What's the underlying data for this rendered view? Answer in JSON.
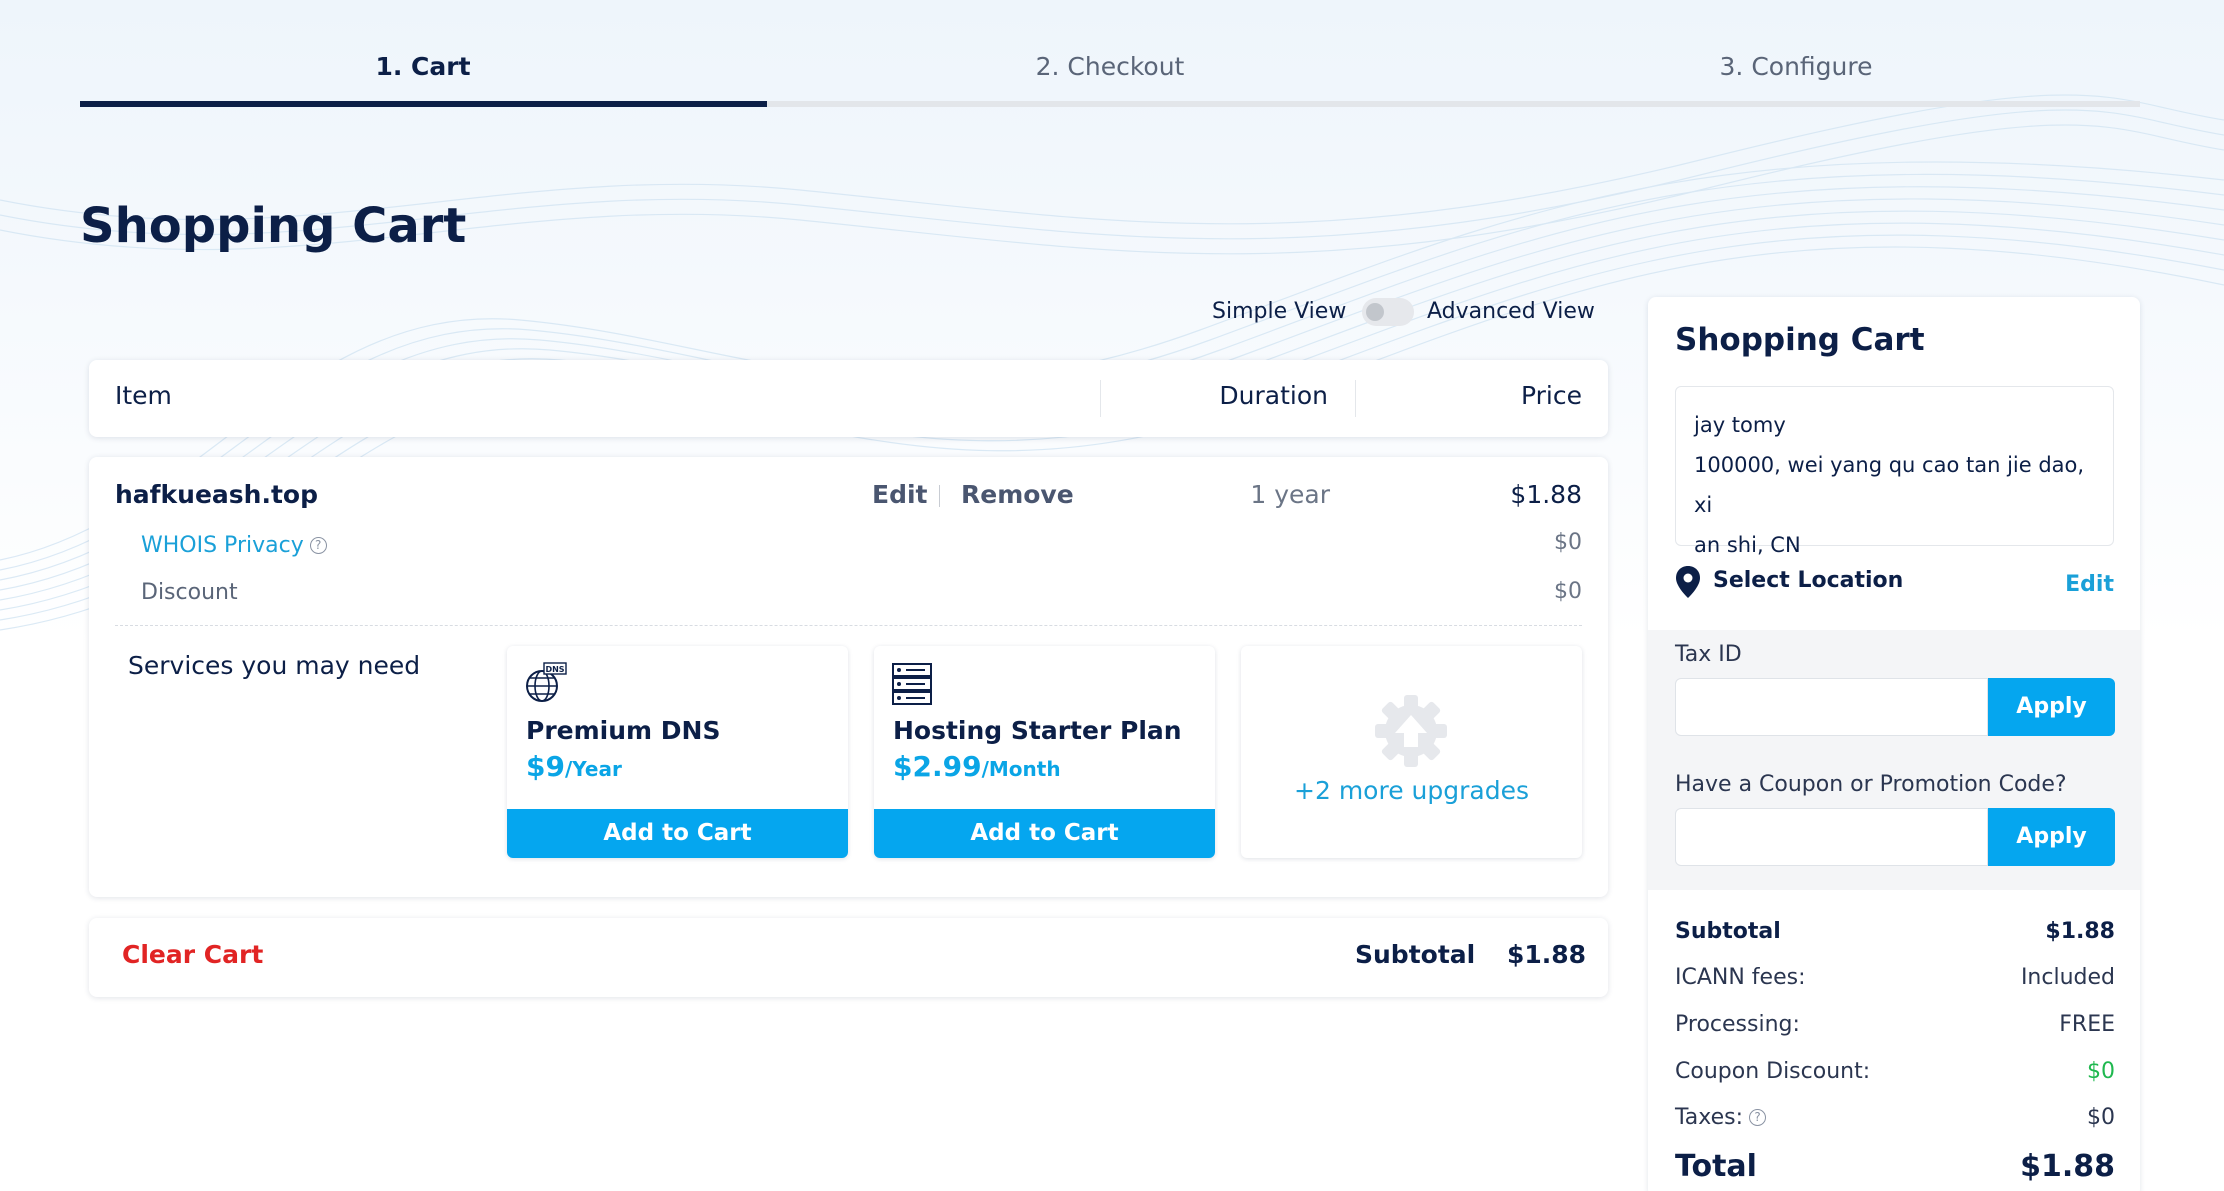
{
  "stepper": {
    "steps": [
      {
        "label": "1. Cart",
        "active": true
      },
      {
        "label": "2. Checkout",
        "active": false
      },
      {
        "label": "3. Configure",
        "active": false
      }
    ]
  },
  "page_title": "Shopping Cart",
  "view_toggle": {
    "left_label": "Simple View",
    "right_label": "Advanced View",
    "state": "simple"
  },
  "table_header": {
    "item": "Item",
    "duration": "Duration",
    "price": "Price"
  },
  "cart_item": {
    "domain": "hafkueash.top",
    "edit_label": "Edit",
    "remove_label": "Remove",
    "duration": "1 year",
    "price": "$1.88",
    "whois_label": "WHOIS Privacy",
    "whois_price": "$0",
    "discount_label": "Discount",
    "discount_price": "$0"
  },
  "services": {
    "title": "Services you may need",
    "items": [
      {
        "name": "Premium DNS",
        "price": "$9",
        "period": "/Year",
        "button": "Add to Cart",
        "icon": "dns-globe-icon"
      },
      {
        "name": "Hosting Starter Plan",
        "price": "$2.99",
        "period": "/Month",
        "button": "Add to Cart",
        "icon": "server-icon"
      }
    ],
    "more": "+2 more upgrades"
  },
  "footer": {
    "clear_cart": "Clear Cart",
    "subtotal_label": "Subtotal",
    "subtotal_value": "$1.88"
  },
  "summary": {
    "title": "Shopping Cart",
    "address": {
      "name": "jay tomy",
      "line1": "100000, wei yang qu cao tan jie dao, xi",
      "line2": "an shi, CN"
    },
    "select_location": "Select Location",
    "edit_label": "Edit",
    "tax_id_label": "Tax ID",
    "tax_apply": "Apply",
    "coupon_label": "Have a Coupon or Promotion Code?",
    "coupon_apply": "Apply",
    "rows": {
      "subtotal_label": "Subtotal",
      "subtotal_value": "$1.88",
      "icann_label": "ICANN fees:",
      "icann_value": "Included",
      "processing_label": "Processing:",
      "processing_value": "FREE",
      "coupon_label": "Coupon Discount:",
      "coupon_value": "$0",
      "taxes_label": "Taxes:",
      "taxes_value": "$0",
      "total_label": "Total",
      "total_value": "$1.88"
    }
  },
  "colors": {
    "navy": "#0c1f47",
    "accent": "#05a6ef",
    "link": "#1aa0d8",
    "danger": "#e12424",
    "success": "#1fb84f"
  }
}
